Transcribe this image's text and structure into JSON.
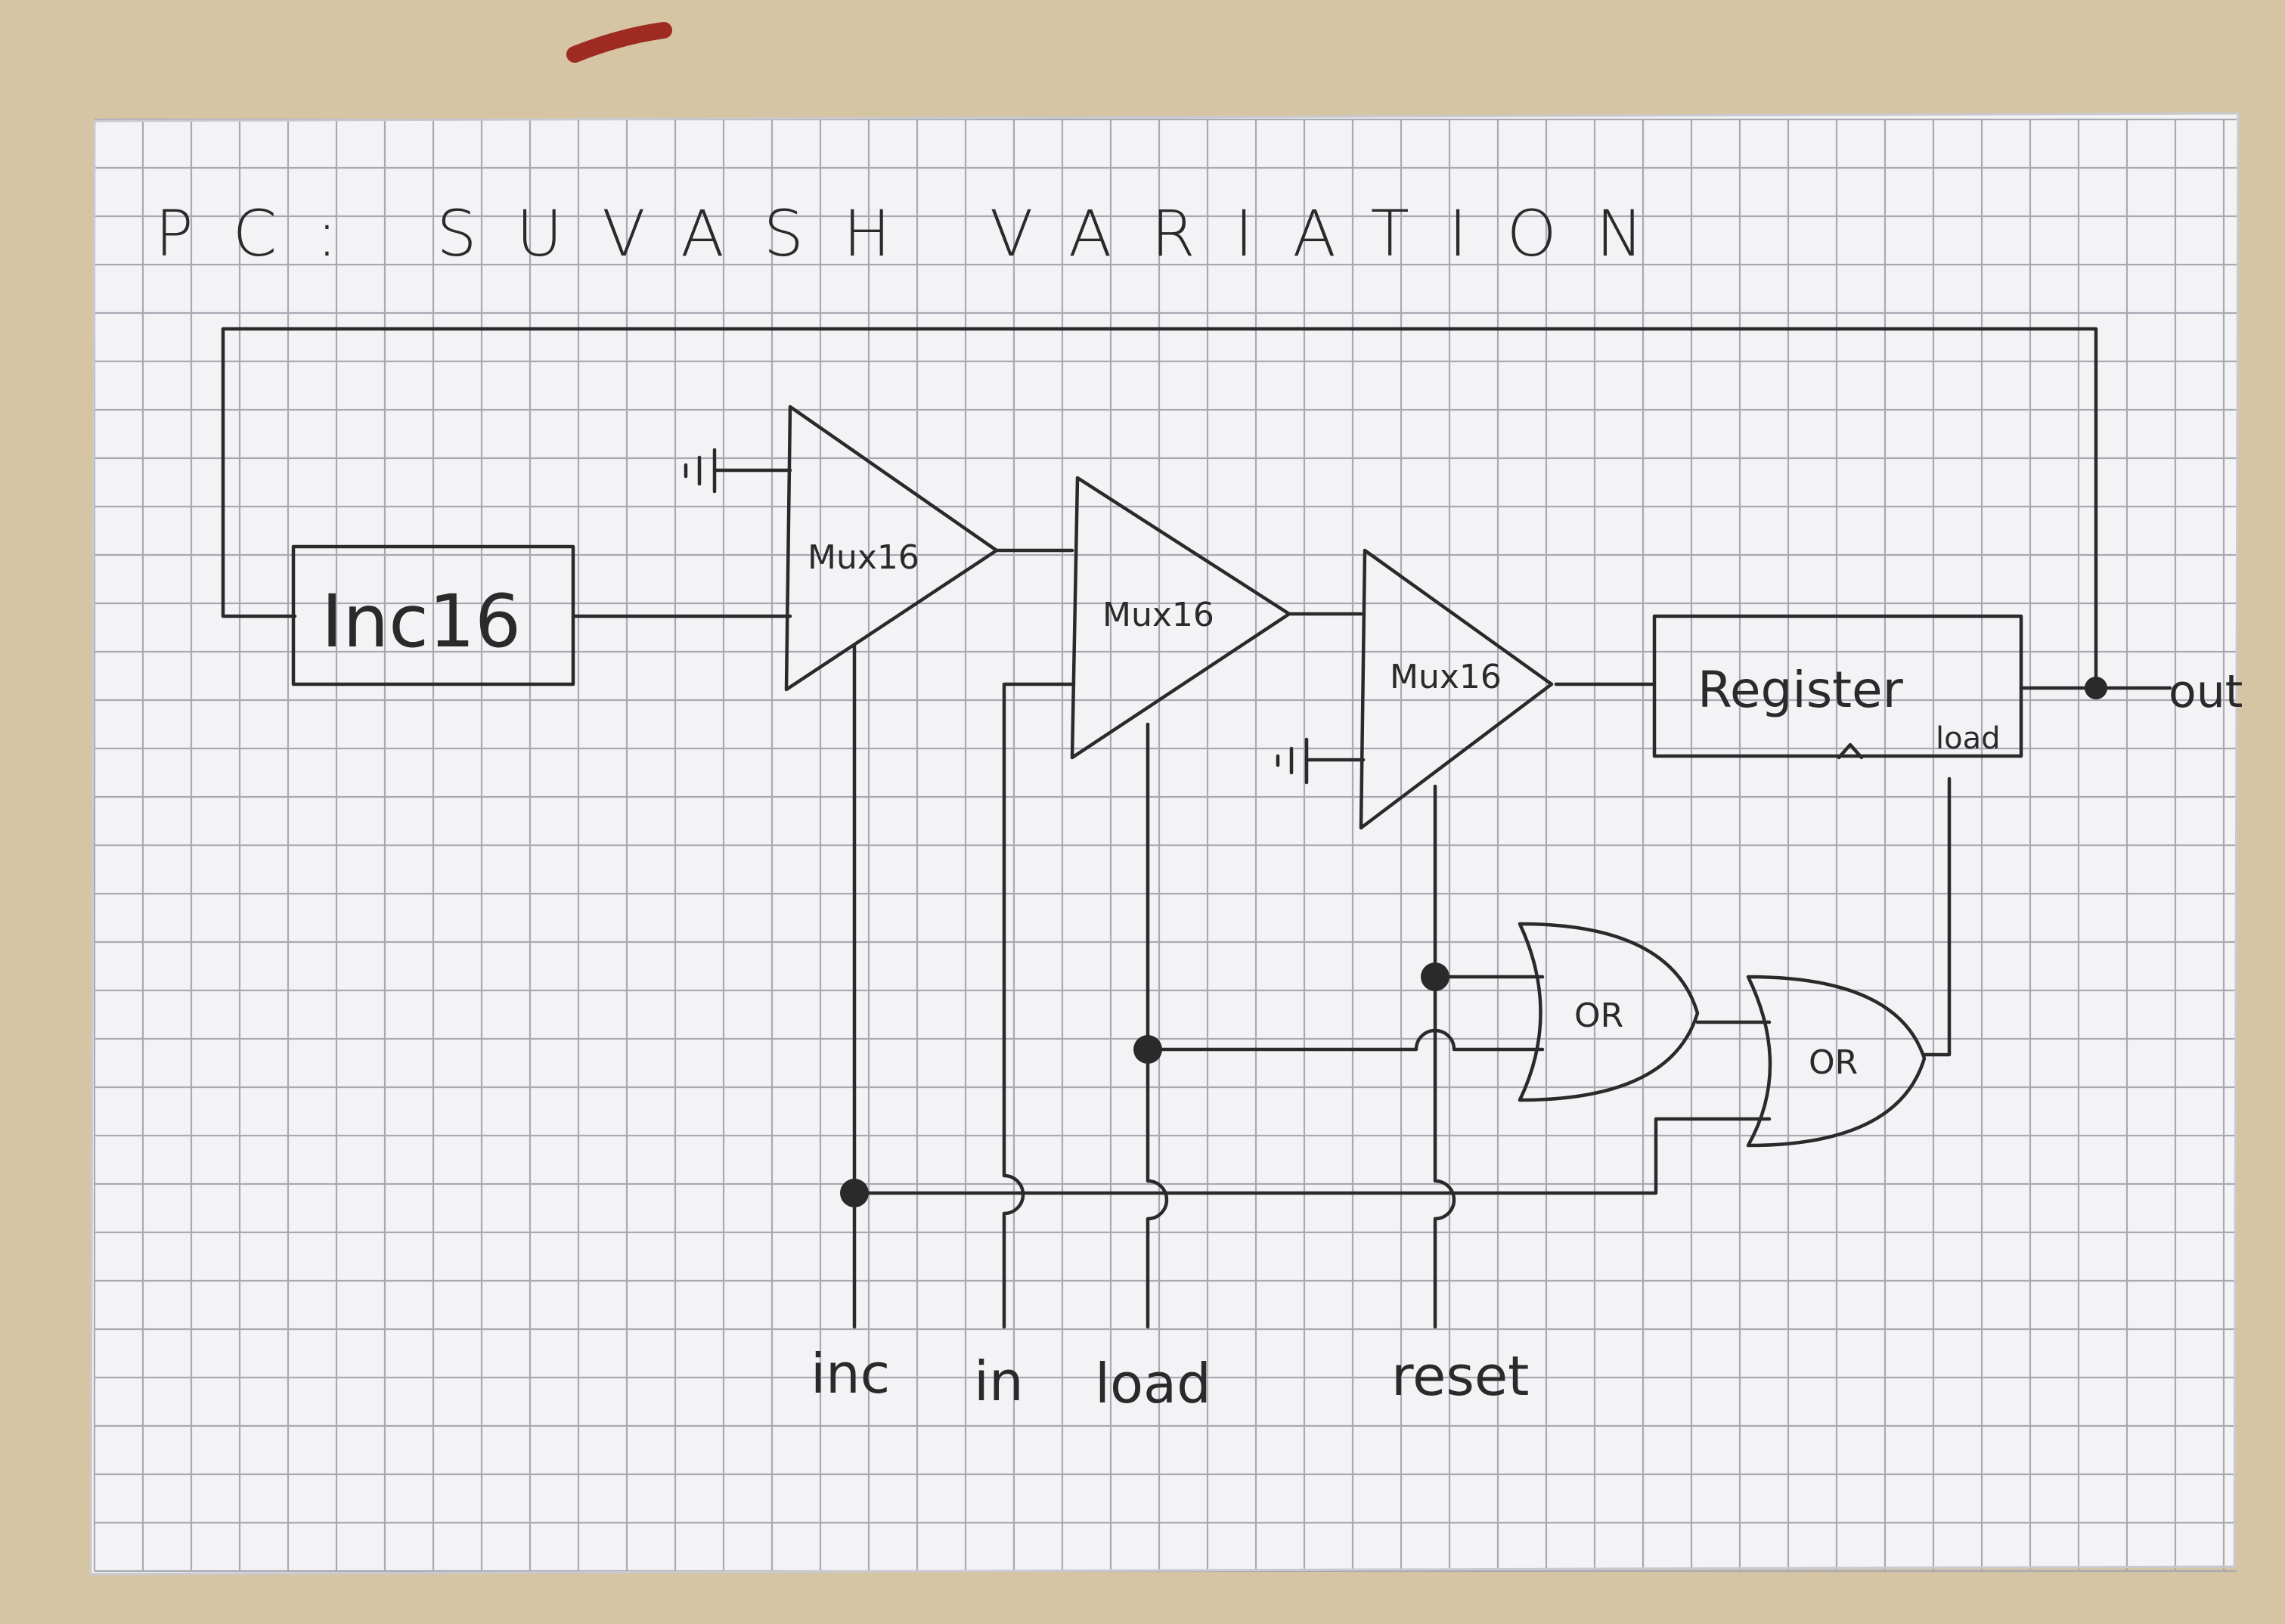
{
  "title": "PC: SUVASH VARIATION",
  "blocks": {
    "inc16": "Inc16",
    "mux1": "Mux16",
    "mux2": "Mux16",
    "mux3": "Mux16",
    "register": "Register",
    "register_load": "load",
    "or1": "OR",
    "or2": "OR"
  },
  "pins": {
    "inc": "inc",
    "in": "in",
    "load": "load",
    "reset": "reset",
    "out": "out"
  },
  "colors": {
    "paper": "#f3f3f6",
    "grid": "#a9a9b2",
    "ink": "#2a2a2a",
    "table": "#d6c5a4",
    "eraser": "#9e2a22"
  }
}
